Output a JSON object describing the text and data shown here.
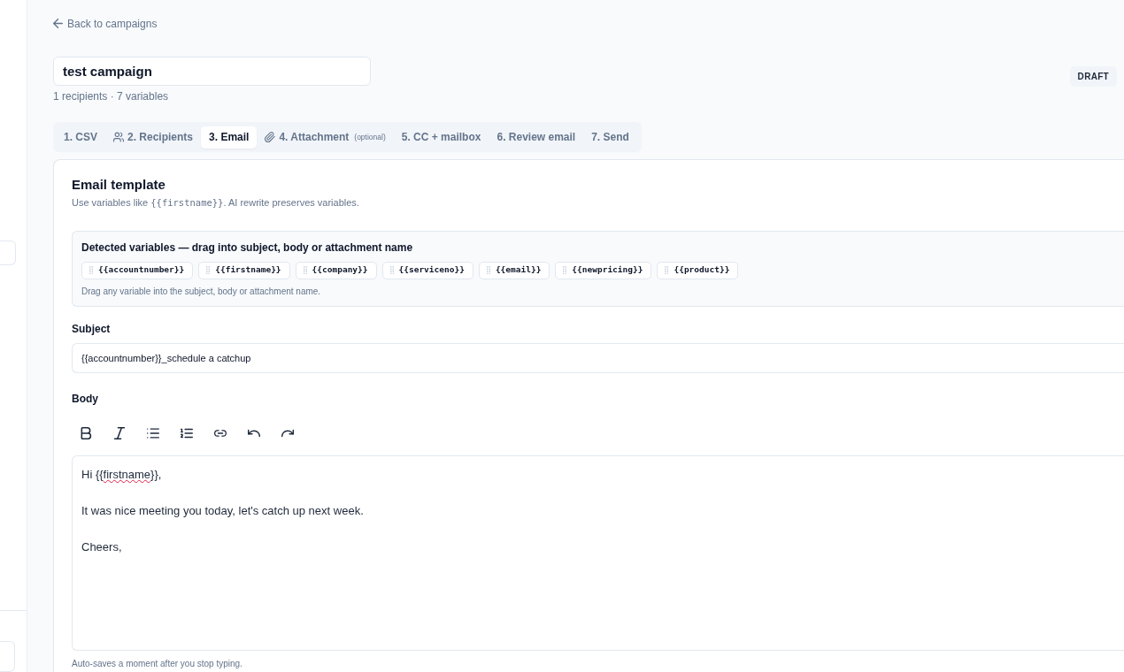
{
  "back_link": {
    "label": "Back to campaigns"
  },
  "campaign": {
    "name": "test campaign",
    "summary": "1 recipients · 7 variables",
    "status": "DRAFT"
  },
  "tabs": [
    {
      "label": "1. CSV",
      "kind": "plain",
      "selected": false
    },
    {
      "label": "2. Recipients",
      "kind": "recipients",
      "selected": false
    },
    {
      "label": "3. Email",
      "kind": "plain",
      "selected": true
    },
    {
      "label": "4. Attachment",
      "note": "(optional)",
      "kind": "attachment",
      "selected": false
    },
    {
      "label": "5. CC + mailbox",
      "kind": "plain",
      "selected": false
    },
    {
      "label": "6. Review email",
      "kind": "plain",
      "selected": false
    },
    {
      "label": "7. Send",
      "kind": "plain",
      "selected": false
    }
  ],
  "email_template": {
    "title": "Email template",
    "hint": [
      {
        "text": "Use variables like ",
        "kind": "text"
      },
      {
        "text": "{{firstname}}",
        "kind": "code"
      },
      {
        "text": ". AI rewrite preserves variables.",
        "kind": "text"
      }
    ]
  },
  "variables": {
    "heading": "Detected variables — drag into subject, body or attachment name",
    "items": [
      "{{accountnumber}}",
      "{{firstname}}",
      "{{company}}",
      "{{serviceno}}",
      "{{email}}",
      "{{newpricing}}",
      "{{product}}"
    ],
    "hint": "Drag any variable into the subject, body or attachment name."
  },
  "subject": {
    "label": "Subject",
    "value": "{{accountnumber}}_schedule a catchup"
  },
  "body": {
    "label": "Body",
    "paragraphs": [
      [
        {
          "text": "Hi {{",
          "misspelled": false
        },
        {
          "text": "firstname",
          "misspelled": true
        },
        {
          "text": "}},",
          "misspelled": false
        }
      ],
      [
        {
          "text": "It was nice meeting you today, let's catch up next week.",
          "misspelled": false
        }
      ],
      [
        {
          "text": "Cheers,",
          "misspelled": false
        }
      ]
    ],
    "footer": "Auto-saves a moment after you stop typing."
  }
}
